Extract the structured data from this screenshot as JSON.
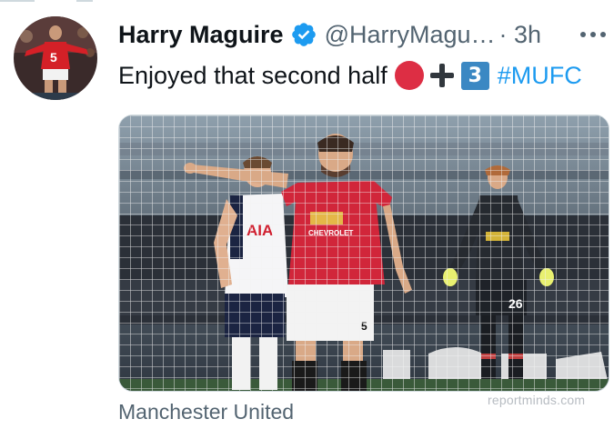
{
  "tweet": {
    "author_name": "Harry Maguire",
    "handle": "@HarryMagu…",
    "separator_time": "· 3h",
    "text": "Enjoyed that second half",
    "emojis": [
      "red-circle",
      "heavy-plus-sign",
      "keycap-3"
    ],
    "keycap_digit": "3",
    "hashtag": "#MUFC",
    "media_caption": "Manchester United",
    "media_watermark": "reportminds.com"
  },
  "colors": {
    "text_primary": "#0f1419",
    "text_secondary": "#536471",
    "verified_blue": "#1d9bf0",
    "hashtag_blue": "#1d9bf0",
    "emoji_red": "#dd2e44",
    "keycap_blue": "#3b88c3"
  },
  "icons": {
    "verified": "verified-badge-icon",
    "more": "more-options-icon"
  }
}
